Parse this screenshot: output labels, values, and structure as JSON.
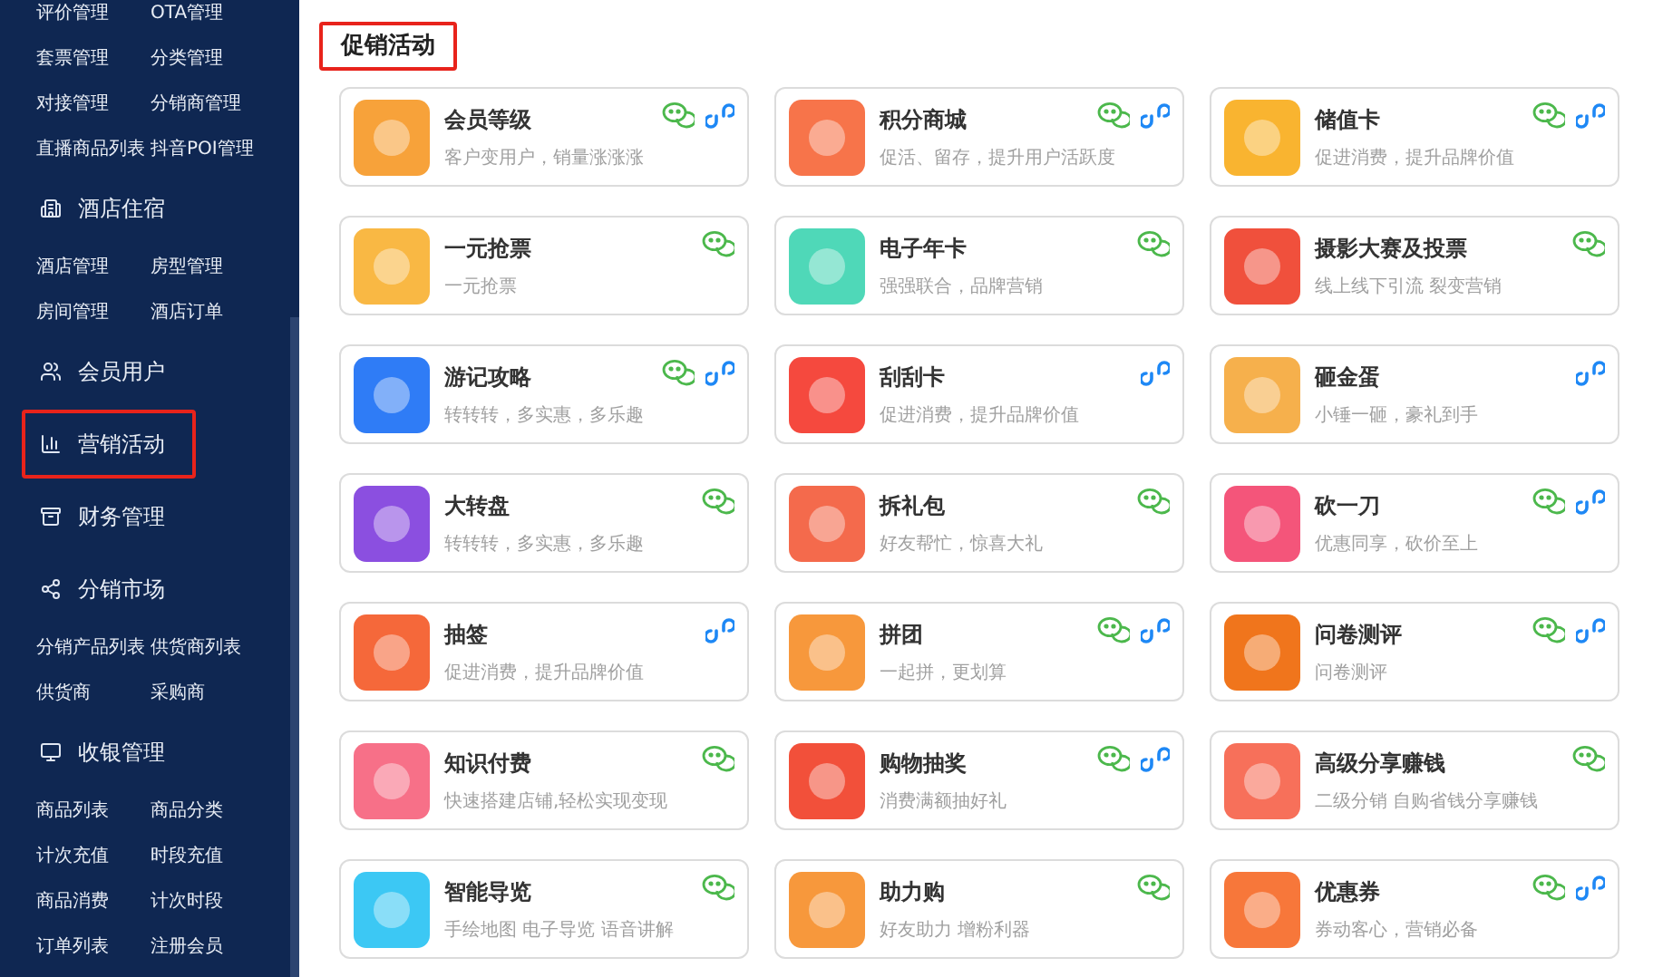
{
  "sidebar": {
    "items": [
      {
        "kind": "links",
        "links": [
          "评价管理",
          "OTA管理"
        ]
      },
      {
        "kind": "links",
        "links": [
          "套票管理",
          "分类管理"
        ]
      },
      {
        "kind": "links",
        "links": [
          "对接管理",
          "分销商管理"
        ]
      },
      {
        "kind": "links",
        "links": [
          "直播商品列表",
          "抖音POI管理"
        ]
      },
      {
        "kind": "section",
        "label": "酒店住宿",
        "highlighted": false
      },
      {
        "kind": "links",
        "links": [
          "酒店管理",
          "房型管理"
        ]
      },
      {
        "kind": "links",
        "links": [
          "房间管理",
          "酒店订单"
        ]
      },
      {
        "kind": "section",
        "label": "会员用户",
        "highlighted": false
      },
      {
        "kind": "section",
        "label": "营销活动",
        "highlighted": true
      },
      {
        "kind": "section",
        "label": "财务管理",
        "highlighted": false
      },
      {
        "kind": "section",
        "label": "分销市场",
        "highlighted": false
      },
      {
        "kind": "links",
        "links": [
          "分销产品列表",
          "供货商列表"
        ]
      },
      {
        "kind": "links",
        "links": [
          "供货商",
          "采购商"
        ]
      },
      {
        "kind": "section",
        "label": "收银管理",
        "highlighted": false
      },
      {
        "kind": "links",
        "links": [
          "商品列表",
          "商品分类"
        ]
      },
      {
        "kind": "links",
        "links": [
          "计次充值",
          "时段充值"
        ]
      },
      {
        "kind": "links",
        "links": [
          "商品消费",
          "计次时段"
        ]
      },
      {
        "kind": "links",
        "links": [
          "订单列表",
          "注册会员"
        ]
      }
    ]
  },
  "main": {
    "title": "促销活动",
    "title_highlighted": true,
    "cards": [
      {
        "title": "会员等级",
        "desc": "客户变用户，销量涨涨涨",
        "color": "#f7a23a",
        "wechat": true,
        "mini_program": true
      },
      {
        "title": "积分商城",
        "desc": "促活、留存，提升用户活跃度",
        "color": "#f7744a",
        "wechat": true,
        "mini_program": true
      },
      {
        "title": "储值卡",
        "desc": "促进消费，提升品牌价值",
        "color": "#f9b430",
        "wechat": true,
        "mini_program": true
      },
      {
        "title": "一元抢票",
        "desc": "一元抢票",
        "color": "#f9b844",
        "wechat": true,
        "mini_program": false
      },
      {
        "title": "电子年卡",
        "desc": "强强联合，品牌营销",
        "color": "#4fd8b8",
        "wechat": true,
        "mini_program": false
      },
      {
        "title": "摄影大赛及投票",
        "desc": "线上线下引流 裂变营销",
        "color": "#f0503c",
        "wechat": true,
        "mini_program": false
      },
      {
        "title": "游记攻略",
        "desc": "转转转，多实惠，多乐趣",
        "color": "#2f7cf6",
        "wechat": true,
        "mini_program": true
      },
      {
        "title": "刮刮卡",
        "desc": "促进消费，提升品牌价值",
        "color": "#f5493e",
        "wechat": false,
        "mini_program": true
      },
      {
        "title": "砸金蛋",
        "desc": "小锤一砸，豪礼到手",
        "color": "#f6b04c",
        "wechat": false,
        "mini_program": true
      },
      {
        "title": "大转盘",
        "desc": "转转转，多实惠，多乐趣",
        "color": "#8b4fe0",
        "wechat": true,
        "mini_program": false
      },
      {
        "title": "拆礼包",
        "desc": "好友帮忙，惊喜大礼",
        "color": "#f46a4c",
        "wechat": true,
        "mini_program": false
      },
      {
        "title": "砍一刀",
        "desc": "优惠同享，砍价至上",
        "color": "#f4557a",
        "wechat": true,
        "mini_program": true
      },
      {
        "title": "抽签",
        "desc": "促进消费，提升品牌价值",
        "color": "#f5683a",
        "wechat": false,
        "mini_program": true
      },
      {
        "title": "拼团",
        "desc": "一起拼，更划算",
        "color": "#f7983c",
        "wechat": true,
        "mini_program": true
      },
      {
        "title": "问卷测评",
        "desc": "问卷测评",
        "color": "#f0751c",
        "wechat": true,
        "mini_program": true
      },
      {
        "title": "知识付费",
        "desc": "快速搭建店铺,轻松实现变现",
        "color": "#f77088",
        "wechat": true,
        "mini_program": false
      },
      {
        "title": "购物抽奖",
        "desc": "消费满额抽好礼",
        "color": "#f2503a",
        "wechat": true,
        "mini_program": true
      },
      {
        "title": "高级分享赚钱",
        "desc": "二级分销 自购省钱分享赚钱",
        "color": "#f7705a",
        "wechat": true,
        "mini_program": false
      },
      {
        "title": "智能导览",
        "desc": "手绘地图 电子导览 语音讲解",
        "color": "#3cc8f4",
        "wechat": true,
        "mini_program": false
      },
      {
        "title": "助力购",
        "desc": "好友助力 增粉利器",
        "color": "#f7983c",
        "wechat": true,
        "mini_program": false
      },
      {
        "title": "优惠券",
        "desc": "券动客心，营销必备",
        "color": "#f7773a",
        "wechat": true,
        "mini_program": true
      }
    ]
  }
}
